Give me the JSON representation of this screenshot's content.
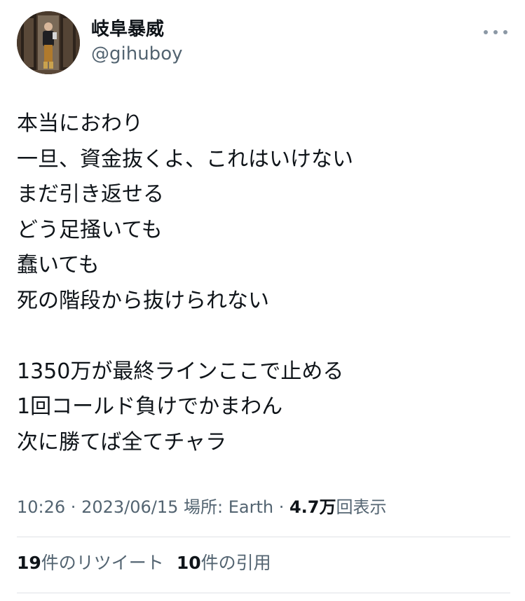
{
  "author": {
    "display_name": "岐阜暴威",
    "handle": "@gihuboy"
  },
  "more_icon": "more-horizontal-icon",
  "body_lines": [
    "本当におわり",
    "一旦、資金抜くよ、これはいけない",
    "まだ引き返せる",
    "どう足掻いても",
    "蠢いても",
    "死の階段から抜けられない",
    "",
    "1350万が最終ラインここで止める",
    "1回コールド負けでかまわん",
    "次に勝てば全てチャラ"
  ],
  "meta": {
    "time": "10:26",
    "sep1": " · ",
    "date": "2023/06/15",
    "location_label": " 場所: ",
    "location": "Earth",
    "sep2": " · ",
    "views_count": "4.7万",
    "views_label": "回表示"
  },
  "stats": {
    "retweets_count": "19",
    "retweets_label": "件のリツイート",
    "quotes_count": "10",
    "quotes_label": "件の引用"
  },
  "colors": {
    "text_primary": "#0f1419",
    "text_secondary": "#536471",
    "divider": "#dfe3e6"
  }
}
